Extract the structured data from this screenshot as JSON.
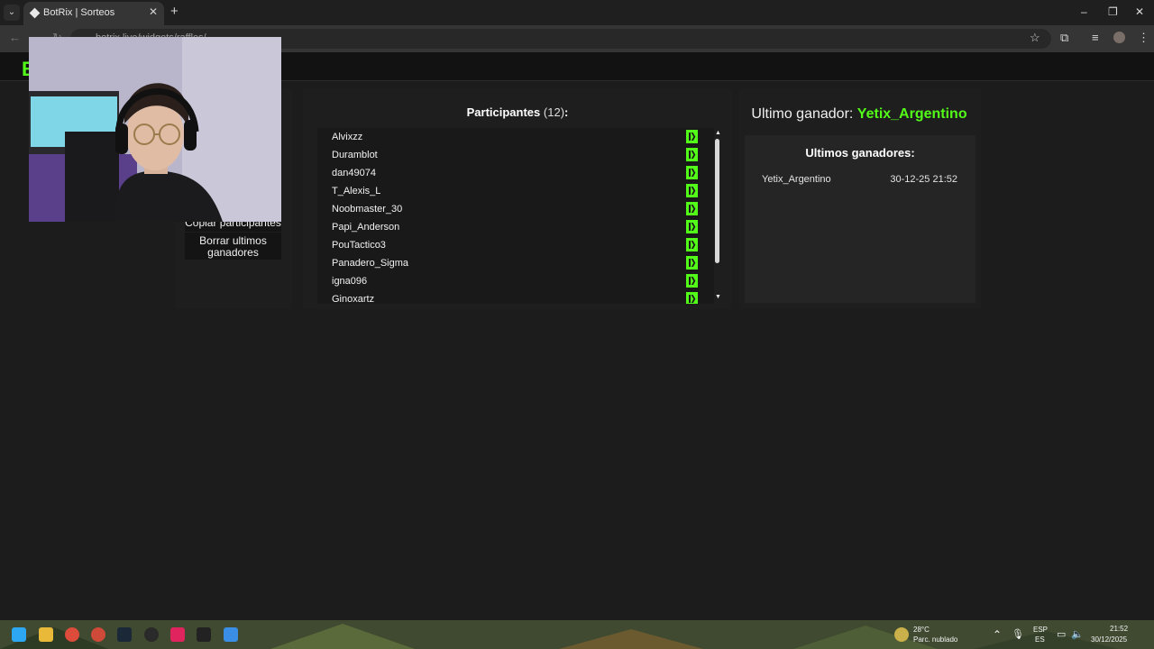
{
  "browser": {
    "tab_title": "BotRix | Sorteos",
    "url": "botrix.live/widgets/raffles/",
    "window_controls": [
      "–",
      "❐",
      "✕"
    ]
  },
  "site": {
    "logo_letter": "B"
  },
  "sidebar": {
    "copy_label": "Copiar participantes",
    "clear_label": "Borrar ultimos ganadores"
  },
  "participants": {
    "title": "Participantes",
    "count": "(12)",
    "colon": ":",
    "items": [
      "Alvixzz",
      "Duramblot",
      "dan49074",
      "T_Alexis_L",
      "Noobmaster_30",
      "Papi_Anderson",
      "PouTactico3",
      "Panadero_Sigma",
      "igna096",
      "Ginoxartz"
    ],
    "platform_icon": "kick-icon",
    "icon_color": "#53fc18"
  },
  "winner": {
    "label": "Ultimo ganador:",
    "name": "Yetix_Argentino",
    "list_title": "Ultimos ganadores:",
    "list": [
      {
        "name": "Yetix_Argentino",
        "date": "30-12-25 21:52"
      }
    ]
  },
  "taskbar": {
    "temperature": "28°C",
    "weather": "Parc. nublado",
    "language_top": "ESP",
    "language_bottom": "ES",
    "time": "21:52",
    "date": "30/12/2025"
  },
  "colors": {
    "accent": "#53fc18",
    "page_bg": "#1c1c1c",
    "panel_bg": "#1e1e1e"
  }
}
